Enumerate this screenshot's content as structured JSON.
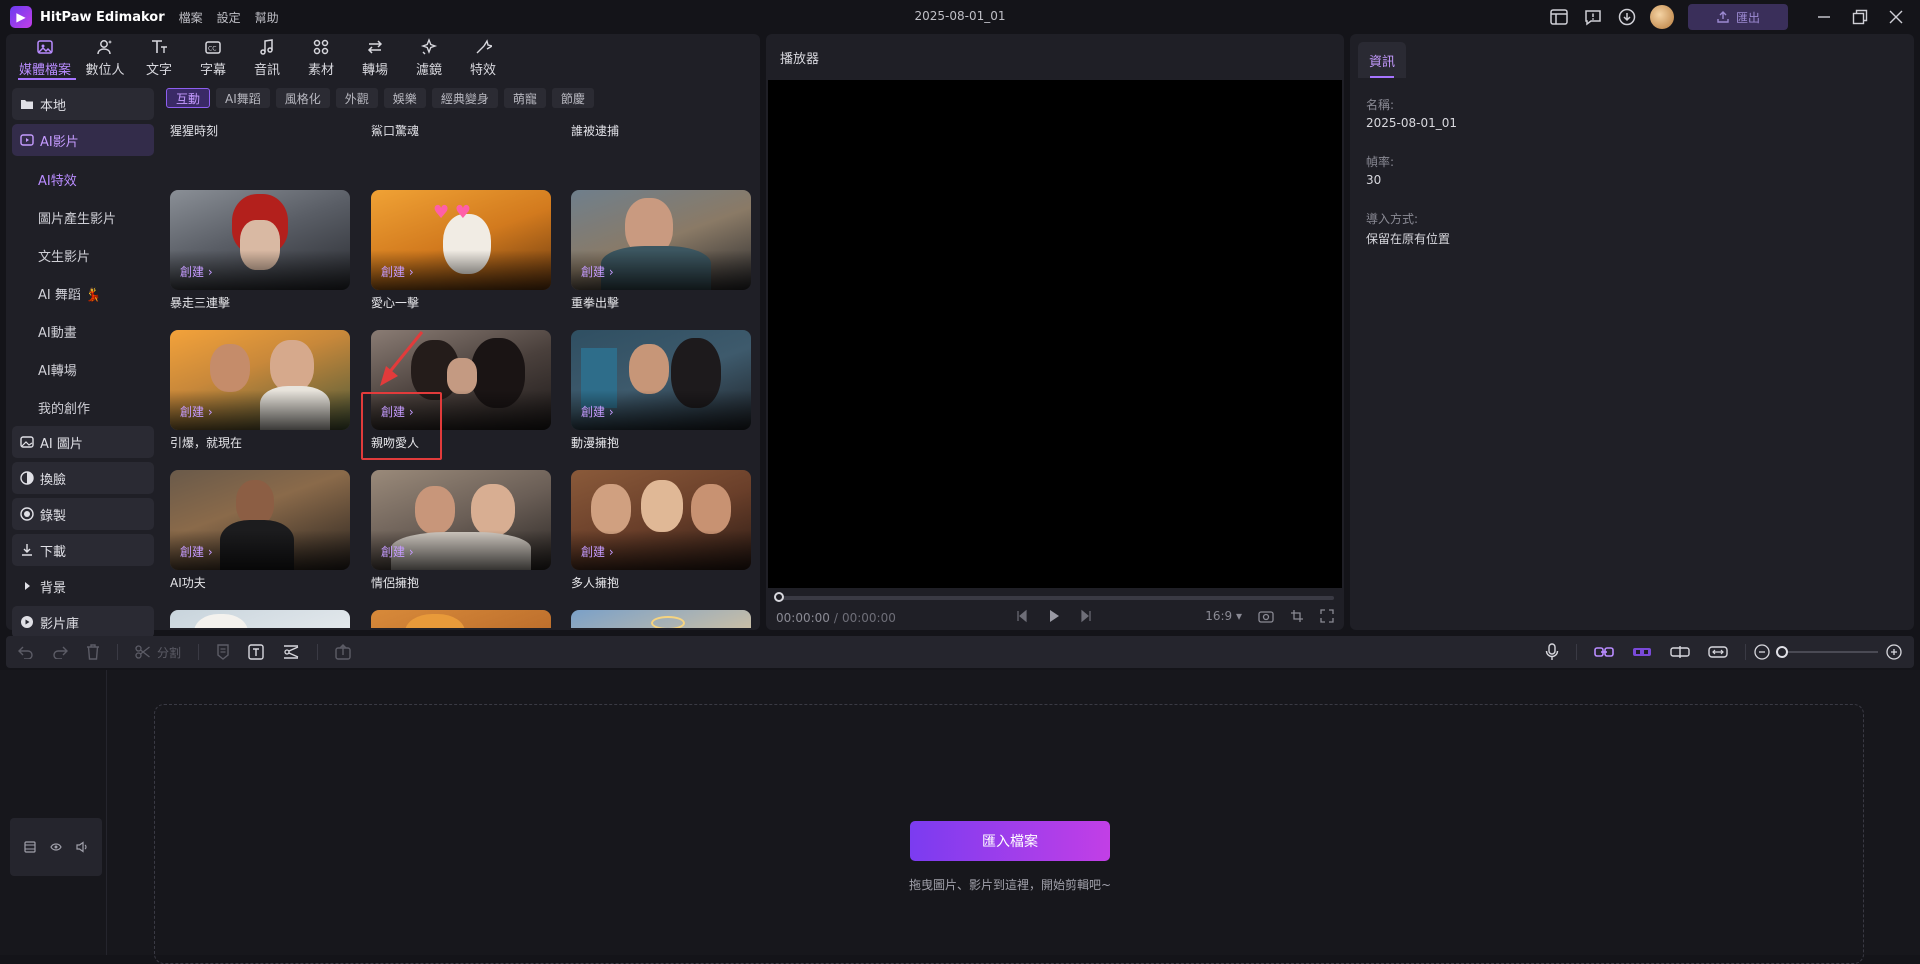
{
  "app": {
    "name": "HitPaw Edimakor",
    "menu": [
      "檔案",
      "設定",
      "幫助"
    ],
    "project_title": "2025-08-01_01",
    "export_label": "匯出"
  },
  "toolbar": {
    "tools": [
      {
        "label": "媒體檔案",
        "icon": "media-icon",
        "active": true
      },
      {
        "label": "數位人",
        "icon": "avatar-person-icon"
      },
      {
        "label": "文字",
        "icon": "text-icon"
      },
      {
        "label": "字幕",
        "icon": "subtitle-icon"
      },
      {
        "label": "音訊",
        "icon": "music-note-icon"
      },
      {
        "label": "素材",
        "icon": "assets-icon"
      },
      {
        "label": "轉場",
        "icon": "transition-icon"
      },
      {
        "label": "濾鏡",
        "icon": "filter-icon"
      },
      {
        "label": "特效",
        "icon": "effects-icon"
      }
    ]
  },
  "sidenav": {
    "local": "本地",
    "ai_video": "AI影片",
    "sub": [
      "AI特效",
      "圖片產生影片",
      "文生影片",
      "AI 舞蹈 💃",
      "AI動畫",
      "AI轉場",
      "我的創作"
    ],
    "ai_image": "AI 圖片",
    "face_swap": "換臉",
    "record": "錄製",
    "download": "下載",
    "background": "背景",
    "library": "影片庫"
  },
  "categories": [
    "互動",
    "AI舞蹈",
    "風格化",
    "外觀",
    "娛樂",
    "經典變身",
    "萌寵",
    "節慶"
  ],
  "grid": {
    "top_labels": [
      "猩猩時刻",
      "鯊口驚魂",
      "誰被逮捕"
    ],
    "create_label": "創建",
    "rows": [
      [
        "暴走三連擊",
        "愛心一擊",
        "重拳出擊"
      ],
      [
        "引爆，就現在",
        "親吻愛人",
        "動漫擁抱"
      ],
      [
        "AI功夫",
        "情侶擁抱",
        "多人擁抱"
      ]
    ]
  },
  "player": {
    "title": "播放器",
    "time_current": "00:00:00",
    "time_separator": "/",
    "time_total": "00:00:00",
    "aspect": "16:9"
  },
  "info": {
    "tab": "資訊",
    "name_label": "名稱:",
    "name_value": "2025-08-01_01",
    "fps_label": "幀率:",
    "fps_value": "30",
    "import_label": "導入方式:",
    "import_value": "保留在原有位置"
  },
  "timeline": {
    "split_label": "分割",
    "import_button": "匯入檔案",
    "drop_hint": "拖曳圖片、影片到這裡，開始剪輯吧~"
  },
  "colors": {
    "accent": "#a674ff",
    "highlight": "#e23b3b"
  }
}
